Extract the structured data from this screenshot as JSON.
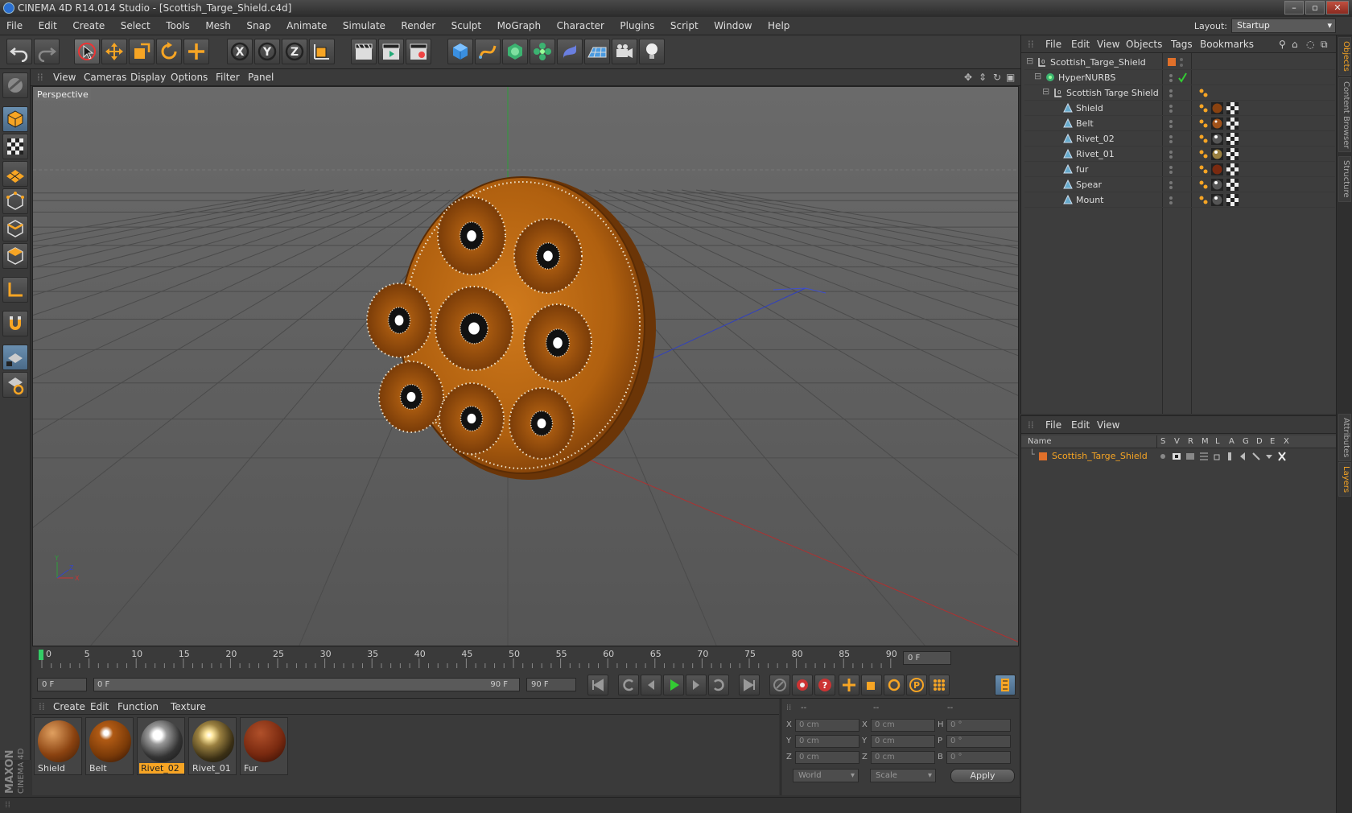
{
  "window": {
    "title": "CINEMA 4D R14.014 Studio - [Scottish_Targe_Shield.c4d]"
  },
  "menubar": {
    "items": [
      "File",
      "Edit",
      "Create",
      "Select",
      "Tools",
      "Mesh",
      "Snap",
      "Animate",
      "Simulate",
      "Render",
      "Sculpt",
      "MoGraph",
      "Character",
      "Plugins",
      "Script",
      "Window",
      "Help"
    ],
    "layout_label": "Layout:",
    "layout_value": "Startup"
  },
  "viewport": {
    "menu": [
      "View",
      "Cameras",
      "Display",
      "Options",
      "Filter",
      "Panel"
    ],
    "label": "Perspective",
    "axis_x": "X",
    "axis_y": "Y",
    "axis_z": "Z"
  },
  "timeline": {
    "ticks": [
      "0",
      "5",
      "10",
      "15",
      "20",
      "25",
      "30",
      "35",
      "40",
      "45",
      "50",
      "55",
      "60",
      "65",
      "70",
      "75",
      "80",
      "85",
      "90"
    ],
    "current_frame": "0 F",
    "start_field": "0 F",
    "slider_start": "0 F",
    "slider_end": "90 F",
    "end_field": "90 F"
  },
  "materials": {
    "menu": [
      "Create",
      "Edit",
      "Function",
      "Texture"
    ],
    "items": [
      {
        "name": "Shield"
      },
      {
        "name": "Belt"
      },
      {
        "name": "Rivet_02"
      },
      {
        "name": "Rivet_01"
      },
      {
        "name": "Fur"
      }
    ]
  },
  "coords": {
    "header": [
      "--",
      "--",
      "--"
    ],
    "rows": [
      {
        "a": "X",
        "av": "0 cm",
        "b": "X",
        "bv": "0 cm",
        "c": "H",
        "cv": "0 °"
      },
      {
        "a": "Y",
        "av": "0 cm",
        "b": "Y",
        "bv": "0 cm",
        "c": "P",
        "cv": "0 °"
      },
      {
        "a": "Z",
        "av": "0 cm",
        "b": "Z",
        "bv": "0 cm",
        "c": "B",
        "cv": "0 °"
      }
    ],
    "world": "World",
    "scale": "Scale",
    "apply": "Apply"
  },
  "objects": {
    "menu": [
      "File",
      "Edit",
      "View",
      "Objects",
      "Tags",
      "Bookmarks"
    ],
    "rows": [
      {
        "name": "Scottish_Targe_Shield"
      },
      {
        "name": "HyperNURBS"
      },
      {
        "name": "Scottish Targe Shield"
      },
      {
        "name": "Shield"
      },
      {
        "name": "Belt"
      },
      {
        "name": "Rivet_02"
      },
      {
        "name": "Rivet_01"
      },
      {
        "name": "fur"
      },
      {
        "name": "Spear"
      },
      {
        "name": "Mount"
      }
    ]
  },
  "layers": {
    "menu": [
      "File",
      "Edit",
      "View"
    ],
    "header_name": "Name",
    "header_cols": [
      "S",
      "V",
      "R",
      "M",
      "L",
      "A",
      "G",
      "D",
      "E",
      "X"
    ],
    "row_name": "Scottish_Targe_Shield"
  },
  "side_tabs": [
    "Objects",
    "Content Browser",
    "Structure",
    "Attributes",
    "Layers"
  ],
  "brand": {
    "line1": "MAXON",
    "line2": "CINEMA 4D"
  },
  "colors": {
    "accent": "#f7a524",
    "shield": "#b8650f"
  }
}
